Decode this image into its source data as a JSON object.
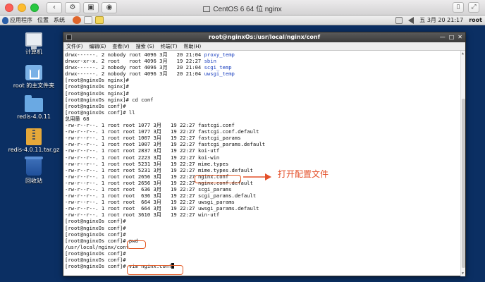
{
  "mac_bar": {
    "title": "CentOS 6 64 位 nginx",
    "right_label": "root"
  },
  "gnome_panel": {
    "menus": [
      "应用程序",
      "位置",
      "系统"
    ],
    "clock": "五 3月 20 21:17",
    "user": "root"
  },
  "desktop": {
    "icons": [
      {
        "label": "计算机"
      },
      {
        "label": "root 的主文件夹"
      },
      {
        "label": "redis-4.0.11"
      },
      {
        "label": "redis-4.0.11.tar.gz"
      },
      {
        "label": "回收站"
      }
    ]
  },
  "terminal": {
    "title": "root@nginxOs:/usr/local/nginx/conf",
    "menu": [
      "文件(F)",
      "编辑(E)",
      "查看(V)",
      "搜索 (S)",
      "终端(T)",
      "帮助(H)"
    ],
    "lines": [
      {
        "pre": "drwx------. 2 nobody root 4096 3月   20 21:04 ",
        "name": "proxy_temp",
        "dir": true
      },
      {
        "pre": "drwxr-xr-x. 2 root   root 4096 3月   19 22:27 ",
        "name": "sbin",
        "dir": true
      },
      {
        "pre": "drwx------. 2 nobody root 4096 3月   20 21:04 ",
        "name": "scgi_temp",
        "dir": true
      },
      {
        "pre": "drwx------. 2 nobody root 4096 3月   20 21:04 ",
        "name": "uwsgi_temp",
        "dir": true
      },
      {
        "pre": "[root@nginxOs nginx]#",
        "name": ""
      },
      {
        "pre": "[root@nginxOs nginx]#",
        "name": ""
      },
      {
        "pre": "[root@nginxOs nginx]#",
        "name": ""
      },
      {
        "pre": "[root@nginxOs nginx]# cd conf",
        "name": ""
      },
      {
        "pre": "[root@nginxOs conf]#",
        "name": ""
      },
      {
        "pre": "[root@nginxOs conf]# ll",
        "name": ""
      },
      {
        "pre": "总用量 68",
        "name": ""
      },
      {
        "pre": "-rw-r--r--. 1 root root 1077 3月   19 22:27 ",
        "name": "fastcgi.conf"
      },
      {
        "pre": "-rw-r--r--. 1 root root 1077 3月   19 22:27 ",
        "name": "fastcgi.conf.default"
      },
      {
        "pre": "-rw-r--r--. 1 root root 1007 3月   19 22:27 ",
        "name": "fastcgi_params"
      },
      {
        "pre": "-rw-r--r--. 1 root root 1007 3月   19 22:27 ",
        "name": "fastcgi_params.default"
      },
      {
        "pre": "-rw-r--r--. 1 root root 2837 3月   19 22:27 ",
        "name": "koi-utf"
      },
      {
        "pre": "-rw-r--r--. 1 root root 2223 3月   19 22:27 ",
        "name": "koi-win"
      },
      {
        "pre": "-rw-r--r--. 1 root root 5231 3月   19 22:27 ",
        "name": "mime.types"
      },
      {
        "pre": "-rw-r--r--. 1 root root 5231 3月   19 22:27 ",
        "name": "mime.types.default"
      },
      {
        "pre": "-rw-r--r--. 1 root root 2656 3月   19 22:27 ",
        "name": "nginx.conf"
      },
      {
        "pre": "-rw-r--r--. 1 root root 2656 3月   19 22:27 ",
        "name": "nginx.conf.default"
      },
      {
        "pre": "-rw-r--r--. 1 root root  636 3月   19 22:27 ",
        "name": "scgi_params"
      },
      {
        "pre": "-rw-r--r--. 1 root root  636 3月   19 22:27 ",
        "name": "scgi_params.default"
      },
      {
        "pre": "-rw-r--r--. 1 root root  664 3月   19 22:27 ",
        "name": "uwsgi_params"
      },
      {
        "pre": "-rw-r--r--. 1 root root  664 3月   19 22:27 ",
        "name": "uwsgi_params.default"
      },
      {
        "pre": "-rw-r--r--. 1 root root 3610 3月   19 22:27 ",
        "name": "win-utf"
      },
      {
        "pre": "[root@nginxOs conf]#",
        "name": ""
      },
      {
        "pre": "[root@nginxOs conf]#",
        "name": ""
      },
      {
        "pre": "[root@nginxOs conf]#",
        "name": ""
      },
      {
        "pre": "[root@nginxOs conf]# pwd",
        "name": ""
      },
      {
        "pre": "/usr/local/nginx/conf",
        "name": ""
      },
      {
        "pre": "[root@nginxOs conf]#",
        "name": ""
      },
      {
        "pre": "[root@nginxOs conf]#",
        "name": ""
      },
      {
        "pre": "[root@nginxOs conf]# vim nginx.conf",
        "name": "",
        "cursor": true
      }
    ]
  },
  "annotation": {
    "label": "打开配置文件",
    "color": "#e4502a"
  }
}
